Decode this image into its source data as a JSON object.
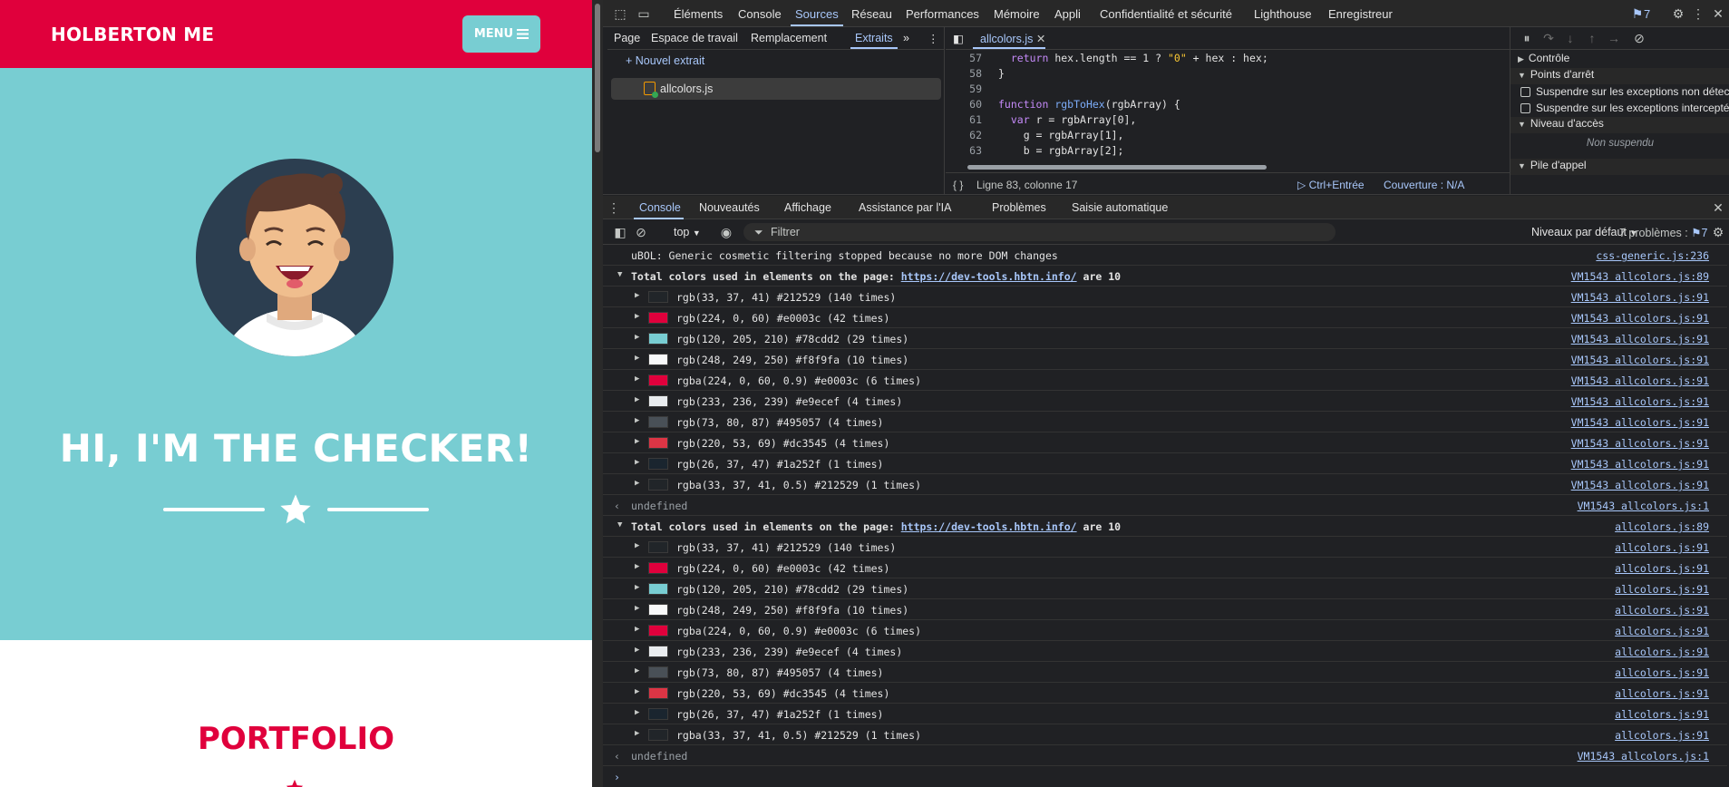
{
  "site": {
    "brand": "HOLBERTON ME",
    "menu_label": "MENU",
    "hero_title": "HI, I'M THE CHECKER!",
    "section_title": "PORTFOLIO"
  },
  "devtools": {
    "tabs": [
      "Éléments",
      "Console",
      "Sources",
      "Réseau",
      "Performances",
      "Mémoire",
      "Appli",
      "Confidentialité et sécurité",
      "Lighthouse",
      "Enregistreur"
    ],
    "issues_badge": "7",
    "sources": {
      "nav_tabs": [
        "Page",
        "Espace de travail",
        "Remplacement",
        "Extraits"
      ],
      "new_snippet": "Nouvel extrait",
      "snippet_file": "allcolors.js",
      "editor_tab": "allcolors.js",
      "code_lines": [
        {
          "n": "57",
          "t": "  return hex.length == 1 ? \"0\" + hex : hex;"
        },
        {
          "n": "58",
          "t": "}"
        },
        {
          "n": "59",
          "t": ""
        },
        {
          "n": "60",
          "t": "function rgbToHex(rgbArray) {"
        },
        {
          "n": "61",
          "t": "  var r = rgbArray[0],"
        },
        {
          "n": "62",
          "t": "    g = rgbArray[1],"
        },
        {
          "n": "63",
          "t": "    b = rgbArray[2];"
        }
      ],
      "status_position": "Ligne 83, colonne 17",
      "status_run": "Ctrl+Entrée",
      "status_coverage": "Couverture : N/A"
    },
    "debugger": {
      "controls": "Contrôle",
      "breakpoints": "Points d'arrêt",
      "pause_uncaught": "Suspendre sur les exceptions non détect",
      "pause_caught": "Suspendre sur les exceptions interceptée",
      "scope": "Niveau d'accès",
      "not_paused": "Non suspendu",
      "call_stack": "Pile d'appel"
    },
    "drawer_tabs": [
      "Console",
      "Nouveautés",
      "Affichage",
      "Assistance par l'IA",
      "Problèmes",
      "Saisie automatique"
    ],
    "console_toolbar": {
      "context": "top",
      "filter_placeholder": "Filtrer",
      "levels": "Niveaux par défaut",
      "problems": "7 problèmes :",
      "problems_count": "7"
    },
    "console": {
      "ubol_msg": "uBOL: Generic cosmetic filtering stopped because no more DOM changes",
      "ubol_src": "css-generic.js:236",
      "group1": {
        "prefix": "Total colors used in elements on the page: ",
        "url": "https://dev-tools.hbtn.info/",
        "suffix": " are 10",
        "src": "VM1543 allcolors.js:89"
      },
      "group1_item_src": "VM1543 allcolors.js:91",
      "undefined_label": "undefined",
      "undefined_src": "VM1543 allcolors.js:1",
      "group2": {
        "prefix": "Total colors used in elements on the page: ",
        "url": "https://dev-tools.hbtn.info/",
        "suffix": " are 10",
        "src": "allcolors.js:89"
      },
      "group2_item_src": "allcolors.js:91",
      "colors": [
        {
          "text": "rgb(33, 37, 41) #212529 (140 times)",
          "swatch": "#212529"
        },
        {
          "text": "rgb(224, 0, 60) #e0003c (42 times)",
          "swatch": "#e0003c"
        },
        {
          "text": "rgb(120, 205, 210) #78cdd2 (29 times)",
          "swatch": "#78cdd2"
        },
        {
          "text": "rgb(248, 249, 250) #f8f9fa (10 times)",
          "swatch": "#f8f9fa"
        },
        {
          "text": "rgba(224, 0, 60, 0.9) #e0003c (6 times)",
          "swatch": "#e0003c"
        },
        {
          "text": "rgb(233, 236, 239) #e9ecef (4 times)",
          "swatch": "#e9ecef"
        },
        {
          "text": "rgb(73, 80, 87) #495057 (4 times)",
          "swatch": "#495057"
        },
        {
          "text": "rgb(220, 53, 69) #dc3545 (4 times)",
          "swatch": "#dc3545"
        },
        {
          "text": "rgb(26, 37, 47) #1a252f (1 times)",
          "swatch": "#1a252f"
        },
        {
          "text": "rgba(33, 37, 41, 0.5) #212529 (1 times)",
          "swatch": "#212529"
        }
      ]
    }
  },
  "colors": {
    "brand_red": "#e0003c",
    "hero_teal": "#78cdd2",
    "devtools_bg": "#202124",
    "devtools_accent": "#a8c7fa"
  }
}
